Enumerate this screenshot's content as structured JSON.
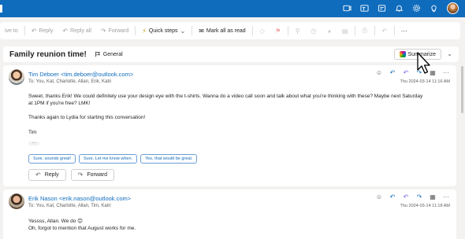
{
  "toolbar": {
    "items": [
      {
        "label": "ive to",
        "icon": "",
        "state": "disabled"
      },
      {
        "label": "Reply",
        "icon": "reply-icon",
        "state": "disabled"
      },
      {
        "label": "Reply all",
        "icon": "reply-all-icon",
        "state": "disabled"
      },
      {
        "label": "Forward",
        "icon": "forward-icon",
        "state": "disabled"
      },
      {
        "label": "Quick steps",
        "icon": "lightning-icon",
        "state": "active"
      },
      {
        "label": "Mark all as read",
        "icon": "envelope-open-icon",
        "state": "active"
      }
    ]
  },
  "conversation": {
    "subject": "Family reunion time!",
    "channel": "General",
    "summarize_label": "Summarize"
  },
  "messages": [
    {
      "from": "Tim Deboer <tim.deboer@outlook.com>",
      "to": "To:  You, Kat, Charlotte, Allan, Erik, Katri",
      "date": "Thu 2024-03-14 11:16 AM",
      "body1": "Sweet, thanks Erik! We could definitely use your design eye with the t-shirts. Wanna do a video call soon and talk about what you're thinking with these? Maybe next Saturday at 1PM if you're free? LMK!",
      "body2": "Thanks again to Lydia for starting this conversation!",
      "signature": "Tim",
      "ellipsis": "...",
      "suggested_replies": [
        "Sure, sounds great!",
        "Sure. Let me know when.",
        "Yes, that would be great."
      ],
      "reply_label": "Reply",
      "forward_label": "Forward"
    },
    {
      "from": "Erik Nason <erik.nason@outlook.com>",
      "to": "To:  You, Kat, Charlotte, Allan, Tim, Katri",
      "date": "Thu 2024-03-14 11:18 AM",
      "body1": "Yessss, Allan. We do 😊",
      "body2": "Oh, forgot to mention that August works for me."
    }
  ],
  "colors": {
    "brand": "#0f6cbd",
    "background": "#f3f2f1",
    "surface": "#ffffff"
  }
}
